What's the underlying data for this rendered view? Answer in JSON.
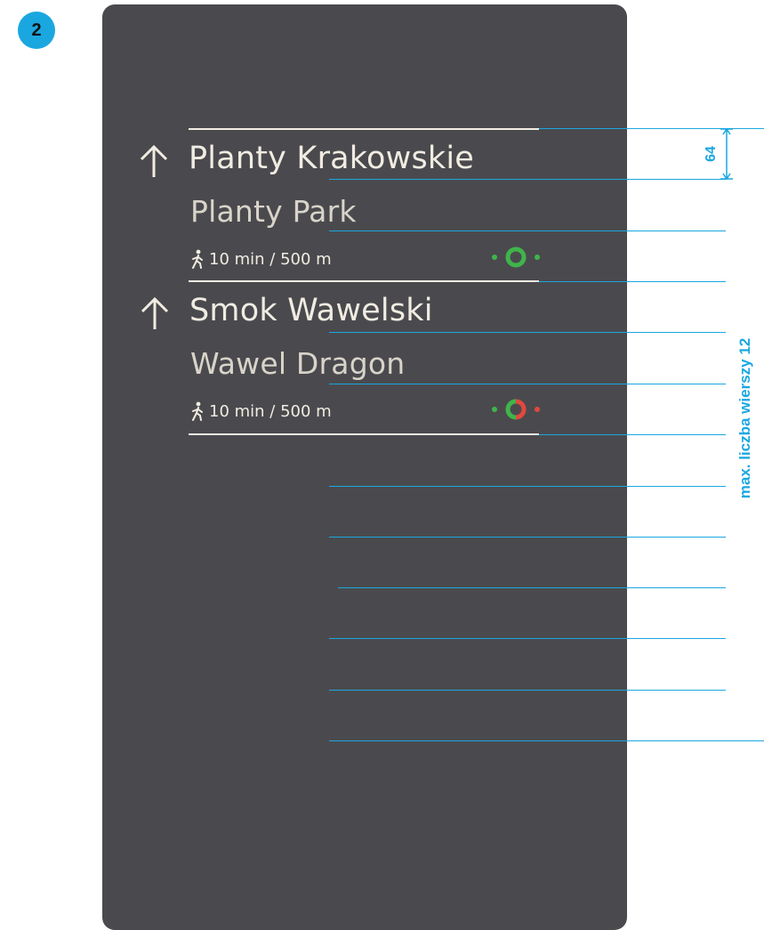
{
  "step_number": "2",
  "entries": [
    {
      "primary_name": "Planty Krakowskie",
      "secondary_name": "Planty Park",
      "walk_info": "10 min / 500 m",
      "icon": "green-circle-route-icon"
    },
    {
      "primary_name": "Smok Wawelski",
      "secondary_name": "Wawel Dragon",
      "walk_info": "10 min / 500 m",
      "icon": "green-red-circle-route-icon"
    }
  ],
  "annotations": {
    "row_height": "64",
    "max_rows_label": "max. liczba wierszy 12"
  },
  "colors": {
    "panel": "#4a4a4e",
    "text": "#f1ece2",
    "guide": "#1aa7e0",
    "green": "#3fb54a",
    "red": "#e2483d"
  }
}
